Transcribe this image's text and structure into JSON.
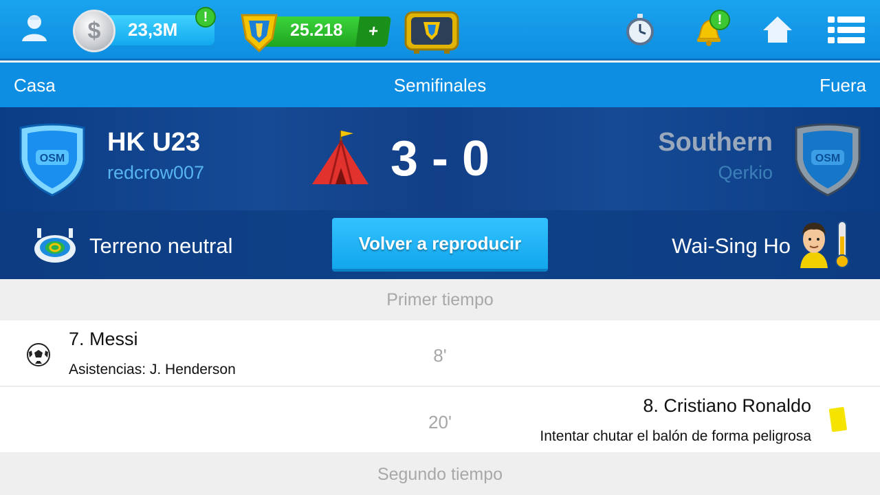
{
  "topbar": {
    "coins": "23,3M",
    "coins_alert": "!",
    "gems": "25.218",
    "gems_plus": "+",
    "bell_alert": "!",
    "icons": [
      "profile-icon",
      "coin-icon",
      "gem-badge-icon",
      "tv-icon",
      "stopwatch-icon",
      "bell-icon",
      "home-icon",
      "menu-icon"
    ]
  },
  "header": {
    "home_label": "Casa",
    "stage_label": "Semifinales",
    "away_label": "Fuera"
  },
  "match": {
    "home_team": "HK U23",
    "home_manager": "redcrow007",
    "away_team": "Southern",
    "away_manager": "Qerkio",
    "score": "3 - 0",
    "venue": "Terreno neutral",
    "replay_button": "Volver a reproducir",
    "referee": "Wai-Sing Ho",
    "shield_text": "OSM"
  },
  "events": {
    "first_half_label": "Primer tiempo",
    "second_half_label": "Segundo tiempo",
    "items": [
      {
        "side": "home",
        "type": "goal",
        "player": "7. Messi",
        "detail": "Asistencias: J. Henderson",
        "minute": "8'"
      },
      {
        "side": "away",
        "type": "yellow-card",
        "player": "8. Cristiano Ronaldo",
        "detail": "Intentar chutar el balón de forma peligrosa",
        "minute": "20'"
      }
    ]
  },
  "colors": {
    "topbar": "#0e8ee0",
    "panel": "#0b3d86",
    "accent_green": "#3cc833",
    "button": "#12a6ec"
  }
}
